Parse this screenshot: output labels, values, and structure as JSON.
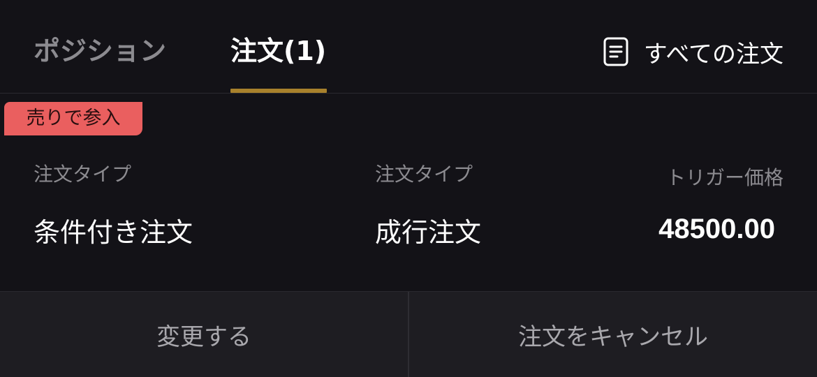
{
  "tabs": {
    "positions_label": "ポジション",
    "orders_label": "注文(1)",
    "active_tab": "orders",
    "accent_color": "#a8812c"
  },
  "all_orders": {
    "label": "すべての注文",
    "icon": "document-list-icon"
  },
  "order": {
    "side_badge": "売りで参入",
    "side_color": "#ea5f5f",
    "fields": [
      {
        "label": "注文タイプ",
        "value": "条件付き注文"
      },
      {
        "label": "注文タイプ",
        "value": "成行注文"
      },
      {
        "label": "トリガー価格",
        "value": "48500.00"
      }
    ]
  },
  "actions": {
    "modify_label": "変更する",
    "cancel_label": "注文をキャンセル"
  }
}
